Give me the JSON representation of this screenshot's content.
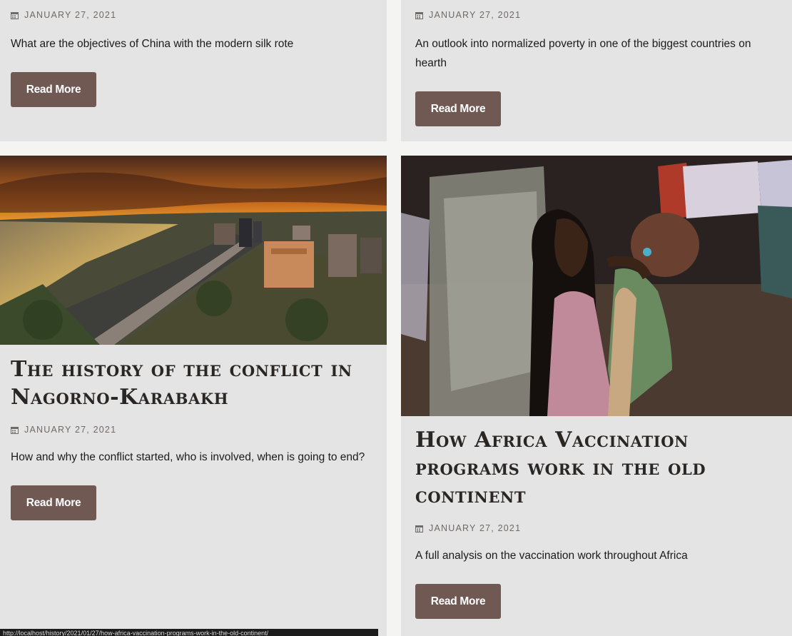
{
  "posts": [
    {
      "date": "JANUARY 27, 2021",
      "excerpt": "What are the objectives of China with the modern silk rote",
      "button": "Read More"
    },
    {
      "date": "JANUARY 27, 2021",
      "excerpt": "An outlook into normalized poverty in one of the biggest countries on hearth",
      "button": "Read More"
    },
    {
      "title": "The history of the conflict in Nagorno-Karabakh",
      "date": "JANUARY 27, 2021",
      "excerpt": "How and why the conflict started, who is involved, when is going to end?",
      "button": "Read More",
      "image": "city-skyline-sunset-photo"
    },
    {
      "title": "How Africa Vaccination programs work in the old continent",
      "date": "JANUARY 27, 2021",
      "excerpt": "A full analysis on the vaccination work throughout Africa",
      "button": "Read More",
      "image": "woman-holding-child-photo"
    }
  ],
  "status_bar": {
    "url": "http://localhost/history/2021/01/27/how-africa-vaccination-programs-work-in-the-old-continent/"
  },
  "colors": {
    "page_background": "#f4f4f3",
    "card_background": "#e4e4e4",
    "button_background": "#715953",
    "button_text": "#ffffff",
    "title_text": "#2a2624",
    "date_text": "#6d6a68"
  },
  "icons": {
    "date": "calendar-icon"
  }
}
